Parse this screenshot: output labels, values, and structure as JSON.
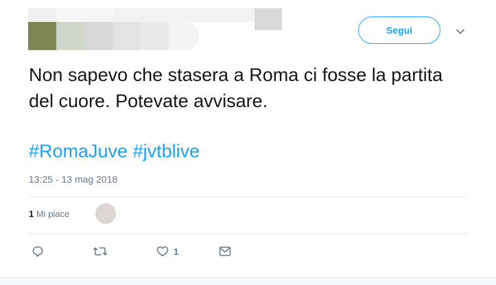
{
  "header": {
    "follow_label": "Segui"
  },
  "tweet": {
    "text": "Non sapevo che stasera a Roma ci fosse la partita del cuore. Potevate avvisare.",
    "hashtags": [
      "#RomaJuve",
      "#jvtblive"
    ],
    "timestamp": "13:25 - 13 mag 2018"
  },
  "stats": {
    "likes_count": "1",
    "likes_label": "Mi piace"
  },
  "actions": {
    "like_count": "1"
  },
  "colors": {
    "accent": "#1da1f2",
    "text": "#14171a",
    "muted": "#657786"
  },
  "icons": [
    "chevron-down-icon",
    "reply-icon",
    "retweet-icon",
    "heart-icon",
    "envelope-icon"
  ]
}
